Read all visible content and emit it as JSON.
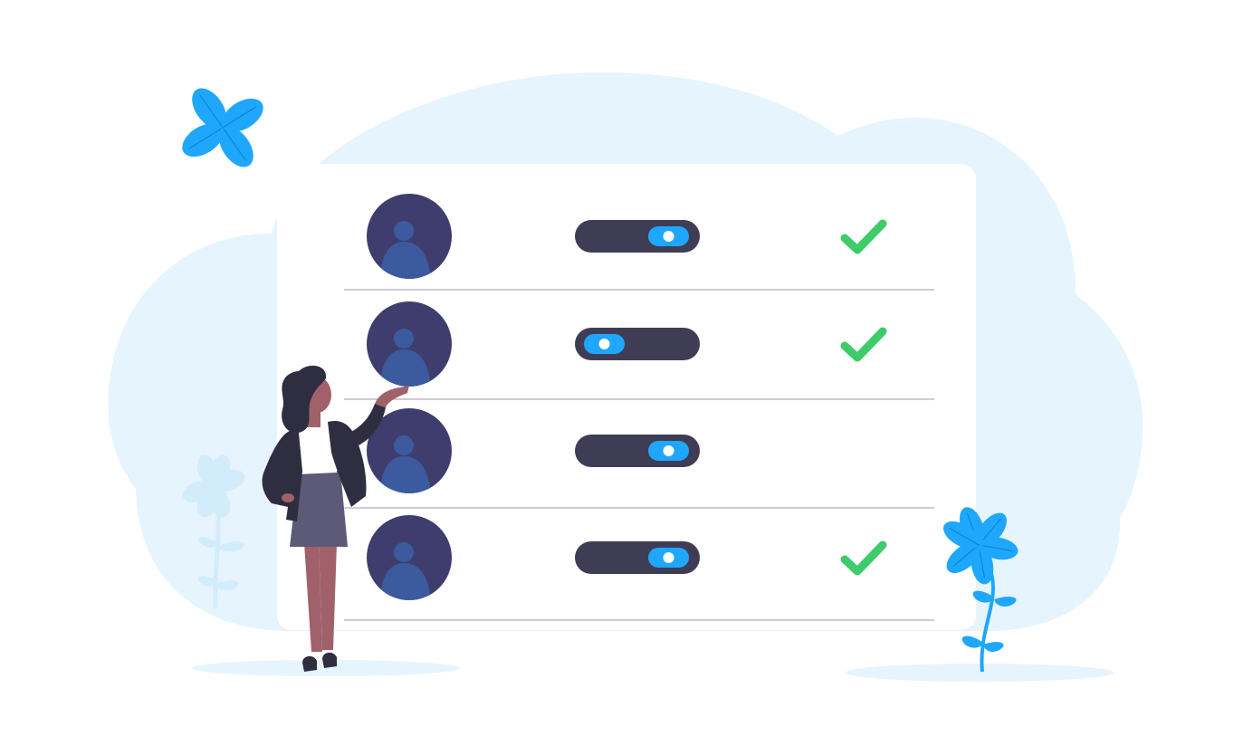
{
  "theme": {
    "cloud": "#e6f4fd",
    "card": "#ffffff",
    "avatar_bg": "#3f3d6e",
    "avatar_person": "#3c5a9e",
    "toggle_track": "#3f3d56",
    "toggle_knob": "#1ea7fd",
    "check": "#3ecb6a",
    "divider": "#9a9aa6",
    "flower_accent": "#1ea7fd",
    "flower_soft": "#d3ecfb",
    "person_hair": "#2f2e41",
    "person_skin": "#a0616a",
    "person_jacket": "#2f2e41",
    "person_skirt": "#5c5a76",
    "person_shirt": "#ffffff"
  },
  "list": {
    "rows": [
      {
        "toggle_on": true,
        "checked": true
      },
      {
        "toggle_on": false,
        "checked": true
      },
      {
        "toggle_on": true,
        "checked": false
      },
      {
        "toggle_on": true,
        "checked": true
      }
    ]
  },
  "icons": {
    "avatar": "user-avatar-icon",
    "toggle": "toggle-switch-icon",
    "check": "checkmark-icon",
    "flower": "flower-icon"
  }
}
